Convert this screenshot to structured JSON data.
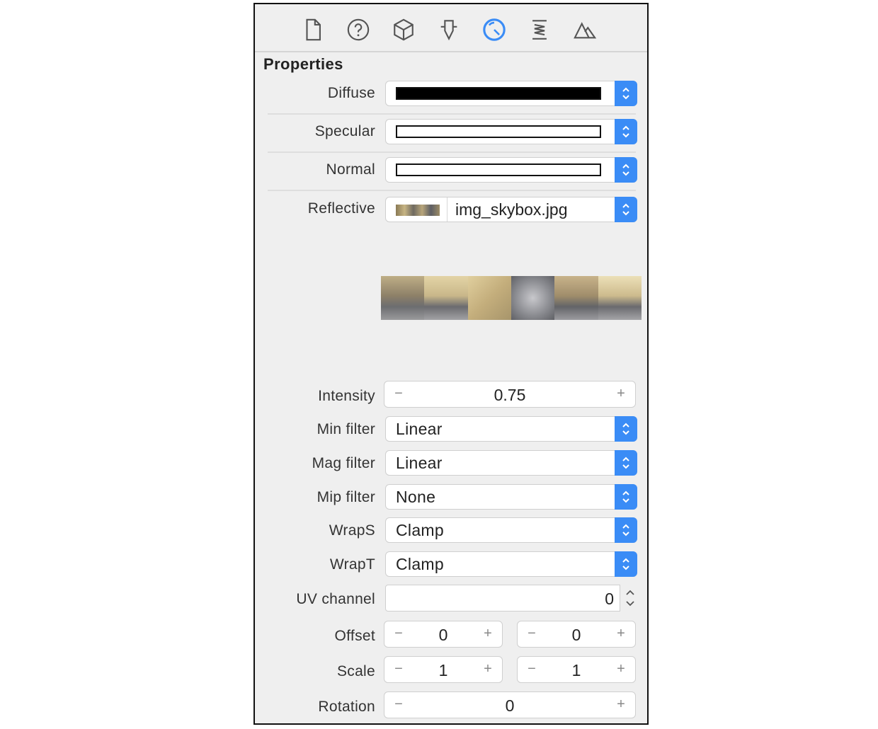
{
  "toolbar": {
    "icons": [
      "file-icon",
      "help-icon",
      "cube-icon",
      "node-icon",
      "material-icon",
      "shader-icon",
      "scene-icon"
    ],
    "active_icon": "material-icon",
    "accent": "#3a8cf6"
  },
  "section_title": "Properties",
  "colors": {
    "diffuse_label": "Diffuse",
    "diffuse_swatch": "#000000",
    "specular_label": "Specular",
    "specular_swatch": "#ffffff",
    "normal_label": "Normal",
    "normal_swatch": "#ffffff"
  },
  "reflective": {
    "label": "Reflective",
    "file": "img_skybox.jpg"
  },
  "intensity": {
    "label": "Intensity",
    "value": "0.75",
    "minus": "−",
    "plus": "+"
  },
  "filters": [
    {
      "label": "Min filter",
      "value": "Linear"
    },
    {
      "label": "Mag filter",
      "value": "Linear"
    },
    {
      "label": "Mip filter",
      "value": "None"
    },
    {
      "label": "WrapS",
      "value": "Clamp"
    },
    {
      "label": "WrapT",
      "value": "Clamp"
    }
  ],
  "uv_channel": {
    "label": "UV channel",
    "value": "0"
  },
  "offset": {
    "label": "Offset",
    "x": "0",
    "y": "0"
  },
  "scale": {
    "label": "Scale",
    "x": "1",
    "y": "1"
  },
  "rotation": {
    "label": "Rotation",
    "value": "0"
  },
  "stepper": {
    "minus": "−",
    "plus": "+"
  }
}
